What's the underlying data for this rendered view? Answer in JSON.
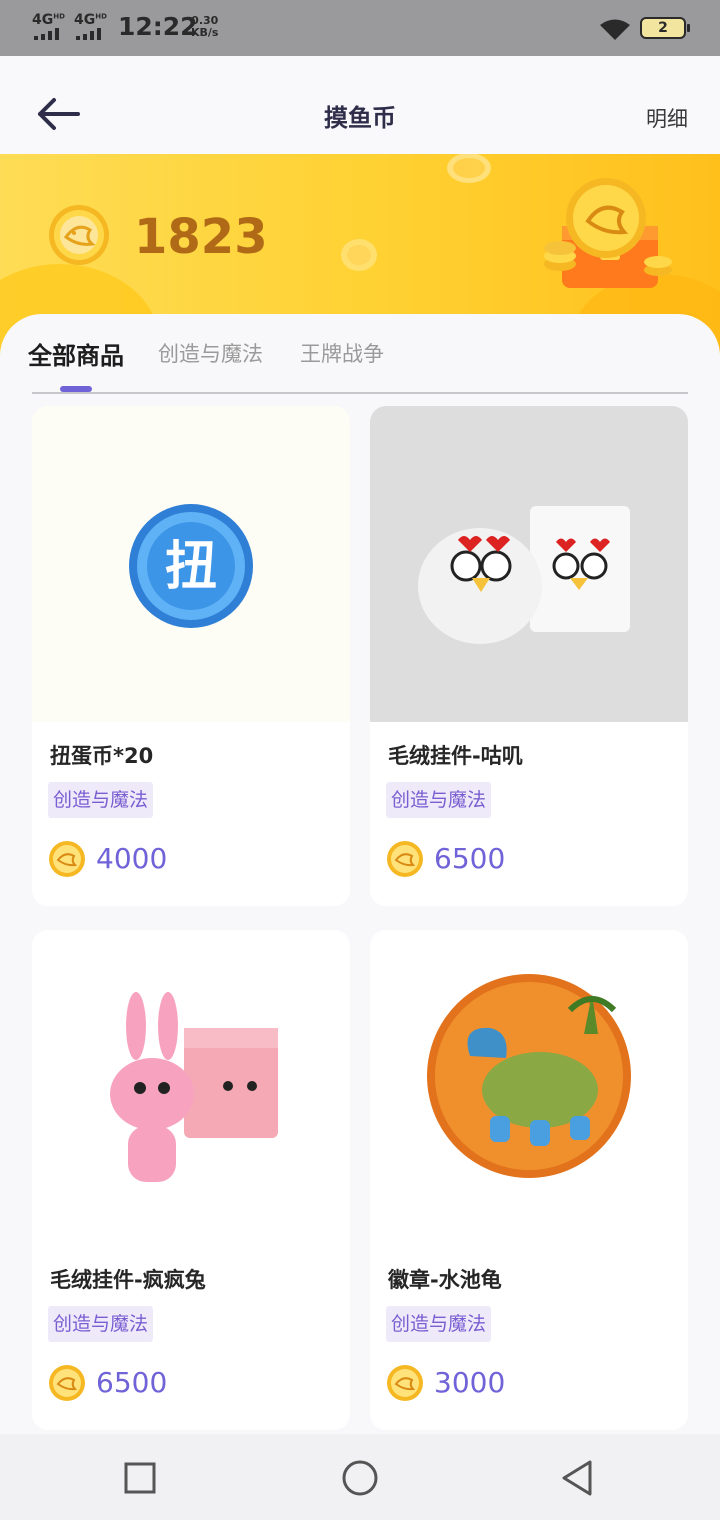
{
  "status_bar": {
    "network_1": "4G",
    "network_2": "4G",
    "hd": "HD",
    "time": "12:22",
    "speed_value": "0.30",
    "speed_unit": "KB/s",
    "battery_level": "2"
  },
  "header": {
    "back_icon": "arrow-left-icon",
    "title": "摸鱼币",
    "detail_label": "明细"
  },
  "balance": {
    "coin_icon": "fish-coin-icon",
    "value": "1823"
  },
  "tabs": [
    {
      "label": "全部商品",
      "active": true
    },
    {
      "label": "创造与魔法",
      "active": false
    },
    {
      "label": "王牌战争",
      "active": false
    }
  ],
  "products": [
    {
      "name": "扭蛋币*20",
      "tag": "创造与魔法",
      "price": "4000",
      "image_icon": "gacha-coin-icon"
    },
    {
      "name": "毛绒挂件-咕叽",
      "tag": "创造与魔法",
      "price": "6500",
      "image_icon": "chicken-plush-icon"
    },
    {
      "name": "毛绒挂件-疯疯兔",
      "tag": "创造与魔法",
      "price": "6500",
      "image_icon": "rabbit-plush-icon"
    },
    {
      "name": "徽章-水池龟",
      "tag": "创造与魔法",
      "price": "3000",
      "image_icon": "turtle-badge-icon"
    }
  ],
  "colors": {
    "accent": "#7063d8",
    "banner": "#ffd234",
    "balance_text": "#b06a17",
    "tag_bg": "#efeafa"
  },
  "nav_bar": [
    "square-icon",
    "circle-icon",
    "triangle-back-icon"
  ]
}
